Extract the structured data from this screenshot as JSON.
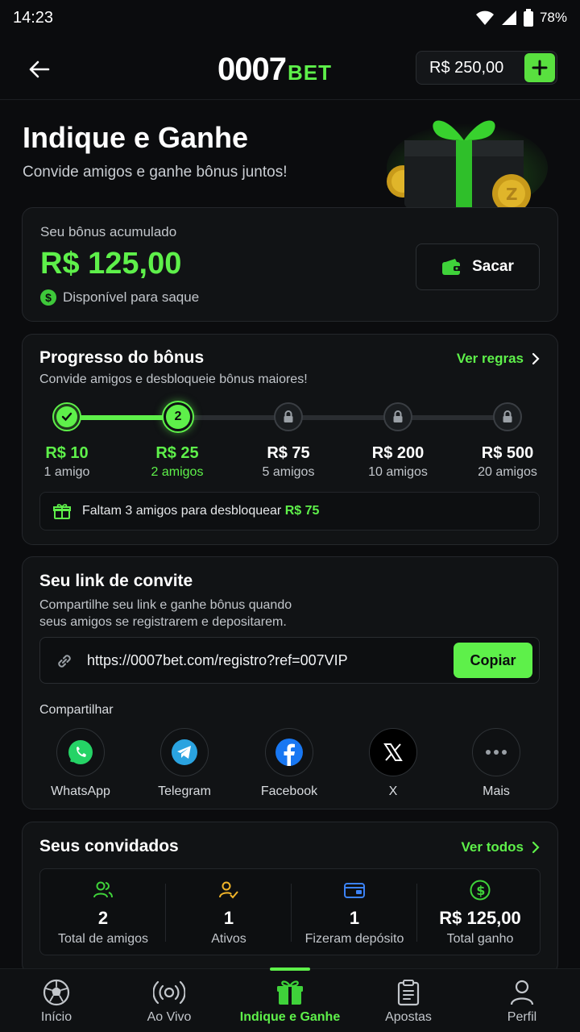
{
  "status_bar": {
    "time": "14:23",
    "battery": "78%"
  },
  "header": {
    "logo_main": "0007",
    "logo_sub": "BET",
    "balance": "R$ 250,00",
    "add_label": "+"
  },
  "hero": {
    "title": "Indique e Ganhe",
    "subtitle": "Convide amigos e ganhe bônus juntos!"
  },
  "bonus": {
    "label": "Seu bônus acumulado",
    "amount": "R$ 125,00",
    "available_text": "Disponível para saque",
    "withdraw_label": "Sacar"
  },
  "progress": {
    "title": "Progresso do bônus",
    "description": "Convide amigos e desbloqueie bônus maiores!",
    "rules_link": "Ver regras",
    "current_step_number": "2",
    "steps": [
      {
        "amount": "R$ 10",
        "friends": "1 amigo",
        "state": "done"
      },
      {
        "amount": "R$ 25",
        "friends": "2 amigos",
        "state": "current"
      },
      {
        "amount": "R$ 75",
        "friends": "5 amigos",
        "state": "locked"
      },
      {
        "amount": "R$ 200",
        "friends": "10 amigos",
        "state": "locked"
      },
      {
        "amount": "R$ 500",
        "friends": "20 amigos",
        "state": "locked"
      }
    ],
    "unlock_text": "Faltam 3 amigos para desbloquear",
    "unlock_amount": "R$ 75"
  },
  "invite": {
    "title": "Seu link de convite",
    "description_line1": "Compartilhe seu link e ganhe bônus quando",
    "description_line2": "seus amigos se registrarem e depositarem.",
    "link": "https://0007bet.com/registro?ref=007VIP",
    "copy_label": "Copiar",
    "share_label": "Compartilhar",
    "share_options": [
      {
        "name": "WhatsApp",
        "icon": "whatsapp-icon",
        "color": "#25d366"
      },
      {
        "name": "Telegram",
        "icon": "telegram-icon",
        "color": "#2aa3e0"
      },
      {
        "name": "Facebook",
        "icon": "facebook-icon",
        "color": "#1877f2"
      },
      {
        "name": "X",
        "icon": "x-icon",
        "color": "#000000"
      },
      {
        "name": "Mais",
        "icon": "more-icon",
        "color": "#9aa0a6"
      }
    ]
  },
  "invited": {
    "title": "Seus convidados",
    "see_all": "Ver todos",
    "stats": [
      {
        "value": "2",
        "label": "Total de amigos",
        "icon": "users-icon"
      },
      {
        "value": "1",
        "label": "Ativos",
        "icon": "user-check-icon"
      },
      {
        "value": "1",
        "label": "Fizeram depósito",
        "icon": "wallet-icon"
      },
      {
        "value": "R$ 125,00",
        "label": "Total ganho",
        "icon": "dollar-icon"
      }
    ]
  },
  "bottom_nav": {
    "items": [
      {
        "label": "Início",
        "icon": "soccer-ball-icon"
      },
      {
        "label": "Ao Vivo",
        "icon": "live-icon"
      },
      {
        "label": "Indique e Ganhe",
        "icon": "gift-icon",
        "active": true
      },
      {
        "label": "Apostas",
        "icon": "clipboard-icon"
      },
      {
        "label": "Perfil",
        "icon": "user-icon"
      }
    ]
  },
  "colors": {
    "accent": "#5ef04a",
    "background": "#0b0c0e",
    "card": "#111315"
  }
}
